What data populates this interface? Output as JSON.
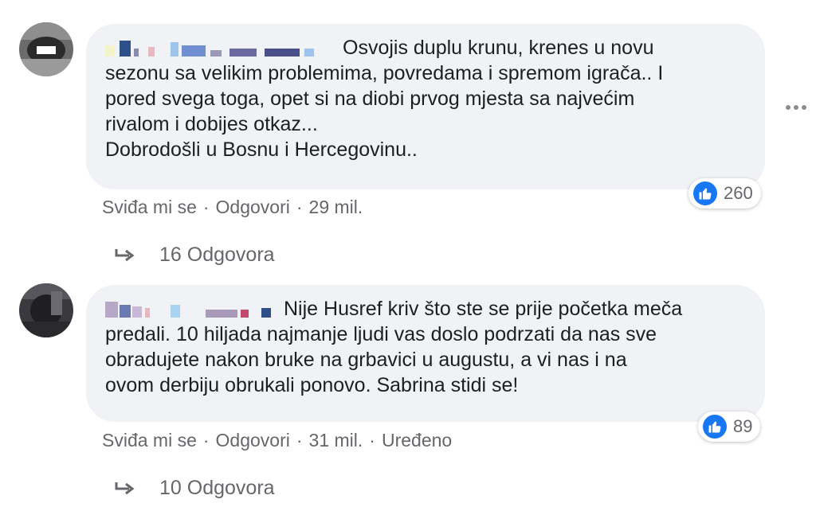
{
  "comments": [
    {
      "text_lines": [
        "Osvojis duplu krunu, krenes u novu",
        "sezonu sa velikim problemima, povredama i spremom igrača.. I",
        "pored svega toga, opet si na diobi prvog mjesta sa najvećim",
        "rivalom i dobijes otkaz...",
        "Dobrodošli u Bosnu i Hercegovinu.."
      ],
      "like_count": "260",
      "actions": {
        "like": "Sviđa mi se",
        "reply": "Odgovori",
        "time": "29 mil.",
        "edited": ""
      },
      "replies_label": "16 Odgovora"
    },
    {
      "text_lines": [
        "Nije Husref kriv što ste se prije početka meča",
        "predali. 10 hiljada najmanje ljudi vas doslo podrzati da nas sve",
        "obradujete nakon bruke na grbavici u augustu, a vi nas i na",
        "ovom derbiju obrukali ponovo. Sabrina stidi se!"
      ],
      "like_count": "89",
      "actions": {
        "like": "Sviđa mi se",
        "reply": "Odgovori",
        "time": "31 mil.",
        "edited": "Uređeno"
      },
      "replies_label": "10 Odgovora"
    }
  ],
  "separator": "·",
  "icons": {
    "like": "thumbs-up-icon",
    "reply": "reply-arrow-icon",
    "more": "more-horizontal-icon"
  },
  "colors": {
    "like_blue": "#1877f2",
    "bubble_bg": "#f0f2f5",
    "secondary_text": "#65676b"
  }
}
